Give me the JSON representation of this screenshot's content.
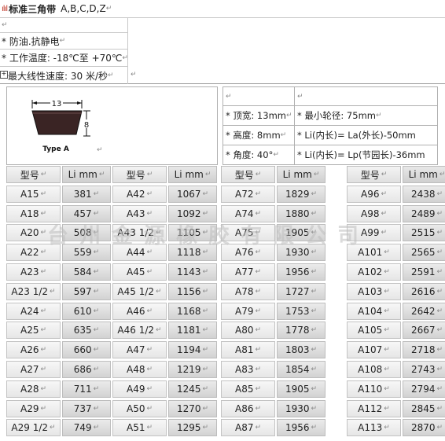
{
  "header": {
    "logo_glyph": "ılıl",
    "title": "标准三角带",
    "types": "A,B,C,D,Z"
  },
  "paragraph_mark": "↵",
  "features": [
    "* 防油.抗静电",
    "* 工作温度: -18℃至 +70℃",
    "最大线性速度: 30 米/秒"
  ],
  "diagram": {
    "width_label": "13",
    "height_label": "8",
    "type_label": "Type A",
    "belt_color": "#3a2424"
  },
  "specs": [
    [
      "* 顶宽: 13mm",
      "* 最小轮径: 75mm"
    ],
    [
      "* 高度: 8mm",
      "* Li(内长)= La(外长)-50mm"
    ],
    [
      "* 角度: 40°",
      "* Li(内长)= Lp(节园长)-36mm"
    ]
  ],
  "table": {
    "headers": [
      "型号",
      "Li mm"
    ],
    "columns": [
      {
        "rows": [
          [
            "A15",
            "381"
          ],
          [
            "A18",
            "457"
          ],
          [
            "A20",
            "508"
          ],
          [
            "A22",
            "559"
          ],
          [
            "A23",
            "584"
          ],
          [
            "A23 1/2",
            "597"
          ],
          [
            "A24",
            "610"
          ],
          [
            "A25",
            "635"
          ],
          [
            "A26",
            "660"
          ],
          [
            "A27",
            "686"
          ],
          [
            "A28",
            "711"
          ],
          [
            "A29",
            "737"
          ],
          [
            "A29 1/2",
            "749"
          ]
        ]
      },
      {
        "rows": [
          [
            "A42",
            "1067"
          ],
          [
            "A43",
            "1092"
          ],
          [
            "A43 1/2",
            "1105"
          ],
          [
            "A44",
            "1118"
          ],
          [
            "A45",
            "1143"
          ],
          [
            "A45 1/2",
            "1156"
          ],
          [
            "A46",
            "1168"
          ],
          [
            "A46 1/2",
            "1181"
          ],
          [
            "A47",
            "1194"
          ],
          [
            "A48",
            "1219"
          ],
          [
            "A49",
            "1245"
          ],
          [
            "A50",
            "1270"
          ],
          [
            "A51",
            "1295"
          ]
        ]
      },
      {
        "rows": [
          [
            "A72",
            "1829"
          ],
          [
            "A74",
            "1880"
          ],
          [
            "A75",
            "1905"
          ],
          [
            "A76",
            "1930"
          ],
          [
            "A77",
            "1956"
          ],
          [
            "A78",
            "1727"
          ],
          [
            "A79",
            "1753"
          ],
          [
            "A80",
            "1778"
          ],
          [
            "A81",
            "1803"
          ],
          [
            "A83",
            "1854"
          ],
          [
            "A85",
            "1905"
          ],
          [
            "A86",
            "1930"
          ],
          [
            "A87",
            "1956"
          ]
        ]
      },
      {
        "rows": [
          [
            "A96",
            "2438"
          ],
          [
            "A98",
            "2489"
          ],
          [
            "A99",
            "2515"
          ],
          [
            "A101",
            "2565"
          ],
          [
            "A102",
            "2591"
          ],
          [
            "A103",
            "2616"
          ],
          [
            "A104",
            "2642"
          ],
          [
            "A105",
            "2667"
          ],
          [
            "A107",
            "2718"
          ],
          [
            "A108",
            "2743"
          ],
          [
            "A110",
            "2794"
          ],
          [
            "A112",
            "2845"
          ],
          [
            "A113",
            "2870"
          ]
        ]
      }
    ]
  },
  "watermark": "台州金源橡胶有限公司"
}
